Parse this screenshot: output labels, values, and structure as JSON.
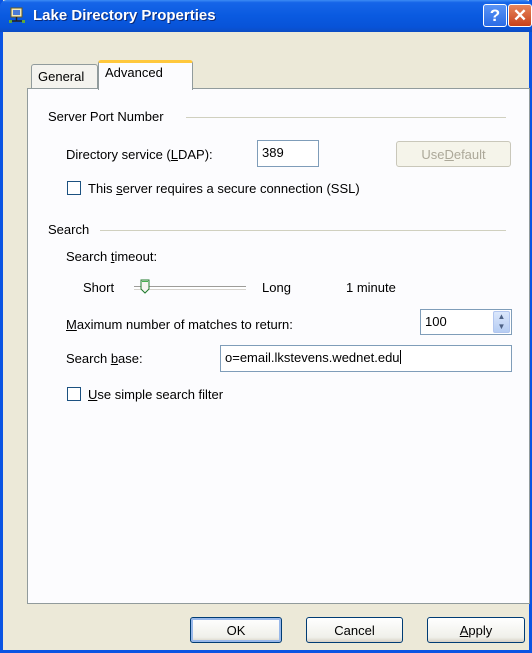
{
  "window": {
    "title": "Lake Directory Properties",
    "help_glyph": "?",
    "close_glyph": "✕"
  },
  "tabs": [
    {
      "label": "General",
      "selected": false
    },
    {
      "label": "Advanced",
      "selected": true
    }
  ],
  "server_port": {
    "group_label": "Server Port Number",
    "ldap_label_pre": "Directory service (",
    "ldap_label_key": "L",
    "ldap_label_post": "DAP):",
    "ldap_value": "389",
    "use_default_pre": "Use ",
    "use_default_key": "D",
    "use_default_post": "efault",
    "ssl_label_pre": "This ",
    "ssl_label_key": "s",
    "ssl_label_post": "erver requires a secure connection (SSL)",
    "ssl_checked": false
  },
  "search": {
    "group_label": "Search",
    "timeout_label_pre": "Search ",
    "timeout_label_key": "t",
    "timeout_label_post": "imeout:",
    "slider_min_label": "Short",
    "slider_max_label": "Long",
    "slider_value_text": "1 minute",
    "slider_level": 0.1,
    "max_matches_key": "M",
    "max_matches_post": "aximum number of matches to return:",
    "max_matches_value": "100",
    "base_label_pre": "Search ",
    "base_label_key": "b",
    "base_label_post": "ase:",
    "base_value": "o=email.lkstevens.wednet.edu",
    "simple_filter_key": "U",
    "simple_filter_post": "se simple search filter",
    "simple_filter_checked": false
  },
  "buttons": {
    "ok": "OK",
    "cancel": "Cancel",
    "apply_key": "A",
    "apply_post": "pply"
  },
  "colors": {
    "titlebar": "#0a5ae0",
    "dialog_face": "#ece9d8",
    "tab_highlight": "#ffc83c"
  },
  "icons": {
    "title": "address-book-network-icon",
    "spinner_up": "arrow-up-icon",
    "spinner_down": "arrow-down-icon"
  }
}
